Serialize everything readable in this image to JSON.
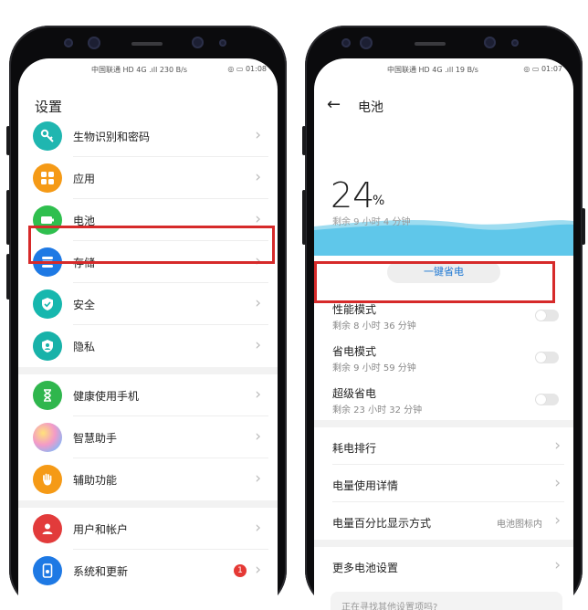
{
  "left": {
    "status": {
      "carrier": "中国联通 HD 4G .ıll 230 B/s",
      "right": "◎ ▭ 01:08"
    },
    "title": "设置",
    "items": [
      {
        "label": "生物识别和密码",
        "icon": "key-icon",
        "color": "#1fb6b0"
      },
      {
        "label": "应用",
        "icon": "apps-icon",
        "color": "#f59a16"
      },
      {
        "label": "电池",
        "icon": "battery-icon",
        "color": "#2fbf4e"
      },
      {
        "label": "存储",
        "icon": "storage-icon",
        "color": "#1e79e4"
      },
      {
        "label": "安全",
        "icon": "shield-icon",
        "color": "#16b7ae"
      },
      {
        "label": "隐私",
        "icon": "privacy-icon",
        "color": "#18b2a9"
      },
      {
        "label": "健康使用手机",
        "icon": "hourglass-icon",
        "color": "#2fb64d"
      },
      {
        "label": "智慧助手",
        "icon": "assistant-icon",
        "color": "#c58de8"
      },
      {
        "label": "辅助功能",
        "icon": "hand-icon",
        "color": "#f59a16"
      },
      {
        "label": "用户和帐户",
        "icon": "user-icon",
        "color": "#e23b3b"
      },
      {
        "label": "系统和更新",
        "icon": "system-icon",
        "color": "#1e79e4",
        "badge": "1"
      }
    ]
  },
  "right": {
    "status": {
      "carrier": "中国联通 HD 4G .ıll 19 B/s",
      "right": "◎ ▭ 01:07"
    },
    "title": "电池",
    "percent": "24",
    "percent_unit": "%",
    "percent_value": 24,
    "remaining": "剩余 9 小时 4 分钟",
    "one_key": "一键省电",
    "modes": [
      {
        "title": "性能模式",
        "sub": "剩余 8 小时 36 分钟"
      },
      {
        "title": "省电模式",
        "sub": "剩余 9 小时 59 分钟"
      },
      {
        "title": "超级省电",
        "sub": "剩余 23 小时 32 分钟"
      }
    ],
    "nav": [
      {
        "title": "耗电排行",
        "value": ""
      },
      {
        "title": "电量使用详情",
        "value": ""
      },
      {
        "title": "电量百分比显示方式",
        "value": "电池图标内"
      }
    ],
    "more": "更多电池设置",
    "suggest": "正在寻找其他设置项吗?",
    "accent": "#1e78d3"
  }
}
